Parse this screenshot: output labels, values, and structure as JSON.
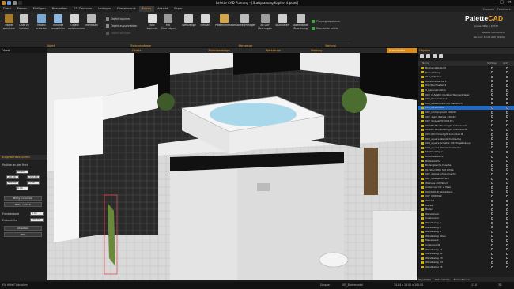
{
  "window": {
    "title": "Palette CAD Planung - [Startplanung Kapitel 4.pcad]"
  },
  "menubar": {
    "items": [
      "Datei",
      "Planen",
      "Einfügen",
      "Bearbeiten",
      "2D Zeichnen",
      "Verlegen",
      "Fliesetechnik",
      "Extras",
      "Ansicht",
      "Export"
    ],
    "active": "Extras",
    "support": "Support",
    "feedback": "Feedback"
  },
  "ribbon": {
    "buttons": [
      {
        "label": "Objekt speichern",
        "icon": "save-object-icon"
      },
      {
        "label": "Liste zu Katalog",
        "icon": "list-icon"
      },
      {
        "label": "Modell erstellen",
        "icon": "model-icon"
      },
      {
        "label": "Variante auswählen",
        "icon": "variant-icon"
      },
      {
        "label": "Objekt umbenennen",
        "icon": "rename-icon"
      },
      {
        "label": "Mit Maßen",
        "icon": "dimension-icon"
      }
    ],
    "object_tools": [
      {
        "label": "Objekt kopieren",
        "state": "normal"
      },
      {
        "label": "Objekt ausschneiden",
        "state": "normal"
      },
      {
        "label": "Objekt einfügen",
        "state": "disabled"
      }
    ],
    "large_buttons": [
      {
        "label": "Bild kopieren",
        "icon": "camera-icon"
      },
      {
        "label": "Mit Überträgen",
        "icon": "brush-icon"
      },
      {
        "label": "Werkzeuge",
        "icon": "hammer-icon"
      },
      {
        "label": "Messen",
        "icon": "measure-icon"
      },
      {
        "label": "Plattenlenmaßer",
        "icon": "ruler-icon"
      },
      {
        "label": "Kachelimmager",
        "icon": "tile-icon"
      },
      {
        "label": "3D DXF Übernagen",
        "icon": "dxf-icon"
      },
      {
        "label": "Stücklisten",
        "icon": "table-icon"
      },
      {
        "label": "Stammdaten Zuordnung",
        "icon": "grid-icon"
      }
    ],
    "maintenance": [
      {
        "label": "Planung reparieren"
      },
      {
        "label": "Geometrie prüfen"
      }
    ],
    "groups": [
      "Objekt",
      "Zwischenablage",
      "Werkzeuge",
      "Wartung"
    ],
    "logo": {
      "text_a": "Palette",
      "text_b": "CAD",
      "sub1": "Palette CAD GmbH",
      "sub2": "Version: 10.00.000 (64bit)",
      "user": "Joana Hilfer | 10537"
    }
  },
  "left_panel": {
    "header": "Objekt",
    "section": "Ausgewähltes Objekt",
    "position_label": "Position an der Front",
    "fields": [
      "15.80",
      "-10.00",
      "-132.00",
      "182.00",
      "-7.00",
      "0.00"
    ],
    "buttons": [
      "Mittig horizontal",
      "Mittig vertikal"
    ],
    "rotation_label": "Frontabstand",
    "rotation_value": "0.00",
    "height_label": "Einbauhöhe",
    "height_value": "100.00",
    "action_buttons": [
      "Abwählen",
      "Hilfe"
    ]
  },
  "viewport": {
    "tab": "Ausschnitte",
    "group_labels": [
      "Objekt",
      "Zwischenablage",
      "Werkzeuge",
      "Wartung"
    ]
  },
  "right_panel": {
    "header": "Objekte",
    "columns": [
      "Name",
      "Sichtbar",
      "Aktiv"
    ],
    "rows": [
      "Blumenständer 4",
      "Beleuchtung",
      "010_Schieber",
      "Wannenbläsche 3",
      "Handtuchhalter 3",
      "0_Rekonstruktion",
      "003_CUVARO modular Wannenträger",
      "007_Wandarmatur",
      "006_Bademantel mit Handtuch",
      "005_Badematte",
      "007_Umhängmatl 100x50",
      "007_deko_Wanne 130x90",
      "007_Spiegel-TC (0x135)",
      "00 LED Mini Downlight Individual K.",
      "00 LED Mini Downlight Individual B.",
      "003 LED Downlight Individual B.",
      "003_square Wandschurbleche",
      "004_square Armatur mit Hügelbräuse",
      "007_square Wandschurbleche",
      "Strahlenkörper",
      "Duschwerkleck",
      "Badezuläche",
      "Bodengleiche Dusche",
      "01_Stand WC Set White",
      "007_Ablage_ohne Dusche",
      "007_Spiegelschrank",
      "Walnuss mit Wand",
      "Individual mit + Vase",
      "09 VIGOUR Bastelbank",
      "007_Mittl 009",
      "Wand 1",
      "Decke",
      "Boden",
      "Wandcheck",
      "Innenwand",
      "Wandbelag 6",
      "Wandbelag 8",
      "Wandbelag B",
      "Wandbelag Dtien",
      "Mauerwerk",
      "Innenwand2",
      "Wandbelag A1",
      "Wandbelag B2",
      "Wandbelag C3",
      "Wandbelag D4",
      "Wandbelag E5"
    ],
    "selected_row": "005_Badematte",
    "bottom_tabs": [
      "Objektliste",
      "Materialliste",
      "Einbaufliesen"
    ]
  },
  "statusbar": {
    "left": "Für Hilfe F1 drücken",
    "center1": "Gruppe",
    "center2": "005_Bademantel",
    "coords": "34.84 x 15.00 x 105.00",
    "zoom": "11.0",
    "mode": "3D"
  },
  "colors": {
    "accent": "#f0a030",
    "selection": "#1e6ac8",
    "tile_dark": "#2a2a2a",
    "floor": "#cfcfcf"
  }
}
